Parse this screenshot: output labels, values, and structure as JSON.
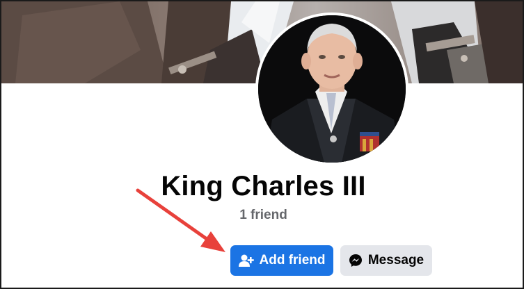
{
  "profile": {
    "name": "King Charles III",
    "friends_count_text": "1 friend"
  },
  "actions": {
    "add_friend_label": "Add friend",
    "message_label": "Message"
  },
  "icons": {
    "add_friend": "person-plus-icon",
    "message": "messenger-icon"
  },
  "colors": {
    "primary_button": "#1b74e4",
    "secondary_button": "#e4e6eb",
    "annotation_arrow": "#e8413b",
    "muted_text": "#65676b"
  }
}
